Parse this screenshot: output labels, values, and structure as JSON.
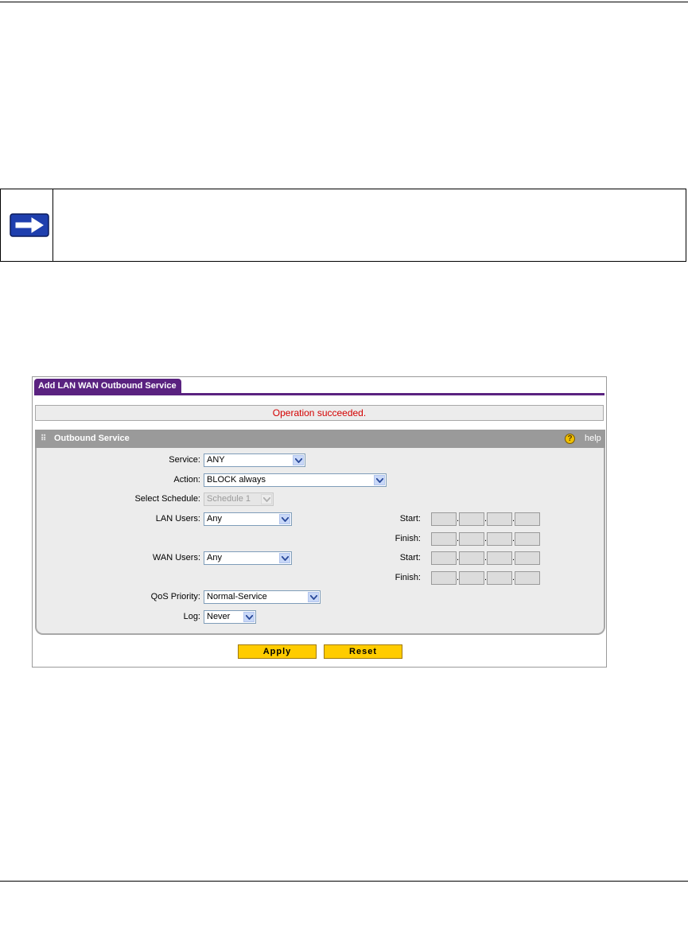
{
  "tab": {
    "title": "Add LAN WAN Outbound Service"
  },
  "status": {
    "message": "Operation succeeded."
  },
  "panel": {
    "title": "Outbound Service",
    "help_label": "help",
    "help_glyph": "?"
  },
  "form": {
    "service": {
      "label": "Service:",
      "value": "ANY"
    },
    "action": {
      "label": "Action:",
      "value": "BLOCK always"
    },
    "schedule": {
      "label": "Select Schedule:",
      "value": "Schedule 1",
      "disabled": true
    },
    "lan_users": {
      "label": "LAN Users:",
      "value": "Any",
      "start_label": "Start:",
      "finish_label": "Finish:"
    },
    "wan_users": {
      "label": "WAN Users:",
      "value": "Any",
      "start_label": "Start:",
      "finish_label": "Finish:"
    },
    "qos": {
      "label": "QoS Priority:",
      "value": "Normal-Service"
    },
    "log": {
      "label": "Log:",
      "value": "Never"
    }
  },
  "buttons": {
    "apply": "Apply",
    "reset": "Reset"
  },
  "colors": {
    "tab": "#5a2280",
    "status_text": "#d40000",
    "button": "#ffcc00",
    "panel_header": "#9a9a9a"
  },
  "icons": {
    "note": "arrow-right-icon",
    "help": "help-icon",
    "grip": "grip-icon",
    "dropdown": "chevron-down-icon"
  }
}
